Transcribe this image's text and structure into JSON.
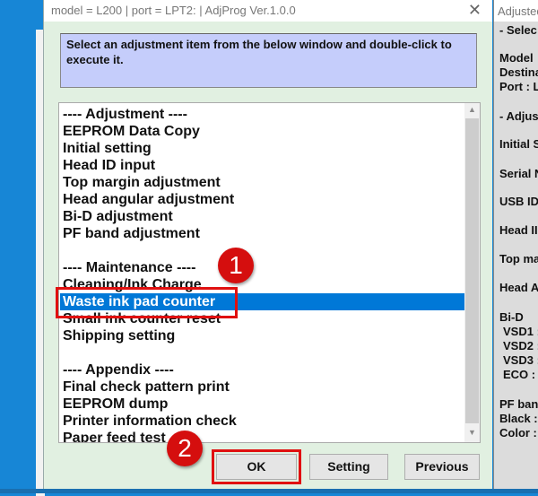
{
  "window": {
    "title": "model = L200 | port = LPT2: | AdjProg Ver.1.0.0",
    "close_icon": "close-icon",
    "instruction": "Select an adjustment item from the below window and double-click to execute it."
  },
  "list": {
    "items": [
      "---- Adjustment ----",
      "EEPROM Data Copy",
      "Initial setting",
      "Head ID input",
      "Top margin adjustment",
      "Head angular adjustment",
      "Bi-D adjustment",
      "PF band adjustment",
      "",
      "---- Maintenance ----",
      "Cleaning/Ink Charge",
      "Waste ink pad counter",
      "Small ink counter reset",
      "Shipping setting",
      "",
      "---- Appendix ----",
      "Final check pattern print",
      "EEPROM dump",
      "Printer information check",
      "Paper feed test"
    ],
    "selected": "Waste ink pad counter"
  },
  "buttons": {
    "ok": "OK",
    "setting": "Setting",
    "previous": "Previous"
  },
  "badges": {
    "one": "1",
    "two": "2"
  },
  "colors": {
    "selection": "#0078d7",
    "highlight": "#e01010",
    "instruction_bg": "#c5cdfb"
  },
  "right_window": {
    "title": "Adjusted",
    "lines": [
      "- Selec",
      "Model",
      "Destina",
      "Port : L",
      "- Adjus",
      "Initial S",
      "Serial N",
      "USB ID",
      "Head II",
      "Top ma",
      "Head A",
      "Bi-D",
      "VSD1 :",
      "VSD2 :",
      "VSD3 :",
      "ECO  :",
      "PF ban",
      "Black :",
      "Color :"
    ]
  }
}
